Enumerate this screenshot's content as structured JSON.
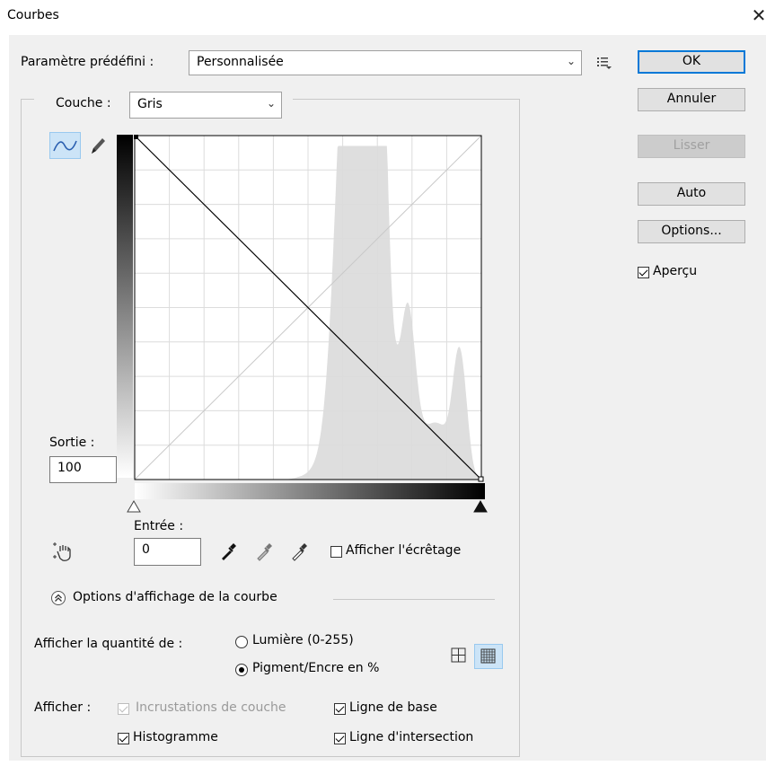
{
  "window": {
    "title": "Courbes",
    "close_glyph": "✕"
  },
  "preset": {
    "label": "Paramètre prédéfini :",
    "value": "Personnalisée",
    "chevron": "⌵"
  },
  "buttons": {
    "ok": "OK",
    "cancel": "Annuler",
    "smooth": "Lisser",
    "auto": "Auto",
    "options": "Options..."
  },
  "preview": {
    "label": "Aperçu",
    "checked": true
  },
  "channel": {
    "label": "Couche :",
    "value": "Gris"
  },
  "output": {
    "label": "Sortie :",
    "value": "100"
  },
  "input": {
    "label": "Entrée :",
    "value": "0"
  },
  "clipping": {
    "label": "Afficher l'écrêtage",
    "checked": false
  },
  "curve_display": {
    "label": "Options d'affichage de la courbe"
  },
  "show_amount": {
    "label": "Afficher la quantité de :",
    "light": "Lumière (0-255)",
    "pigment": "Pigment/Encre en %",
    "selected": "pigment"
  },
  "show": {
    "label": "Afficher :",
    "channel_overlays": "Incrustations de couche",
    "histogram": "Histogramme",
    "baseline": "Ligne de base",
    "intersection": "Ligne d'intersection"
  },
  "icons": {
    "curve_tool": "curve-point-icon",
    "pencil_tool": "pencil-icon",
    "hand_tool": "on-image-adjust-icon",
    "eyedropper_black": "eyedropper-black-icon",
    "eyedropper_gray": "eyedropper-gray-icon",
    "eyedropper_white": "eyedropper-white-icon",
    "preset_menu": "preset-menu-icon",
    "grid_simple": "grid-4-icon",
    "grid_detailed": "grid-10-icon"
  },
  "colors": {
    "accent": "#0078d7",
    "histogram": "#dedede",
    "grid": "#dcdcdc"
  }
}
